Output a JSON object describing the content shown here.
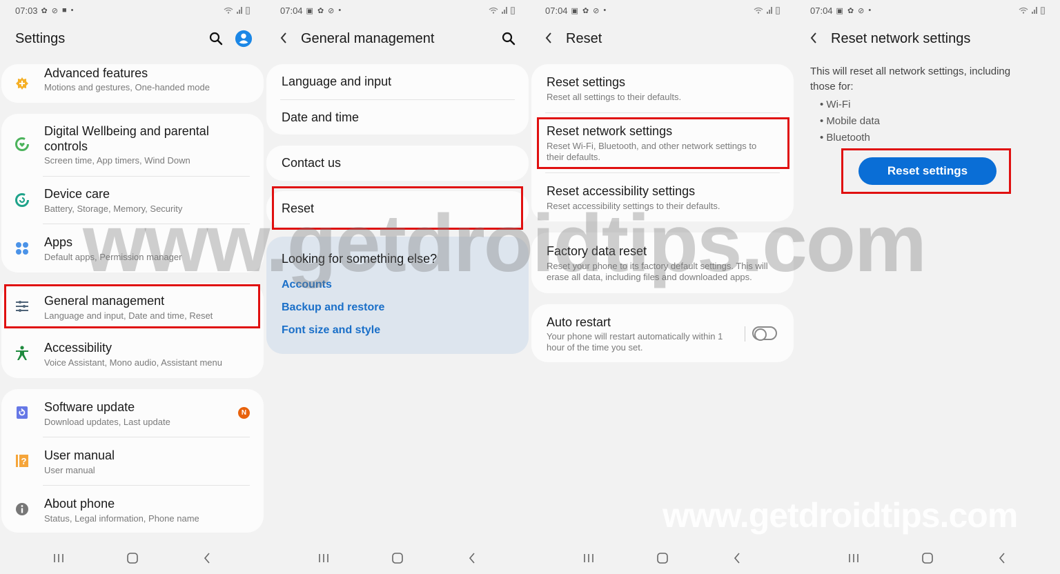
{
  "screens": [
    {
      "status": {
        "time": "07:03"
      },
      "header": {
        "title": "Settings"
      },
      "groups": [
        {
          "items": [
            {
              "title": "Advanced features",
              "subtitle": "Motions and gestures, One-handed mode",
              "icon": "advanced-features-icon"
            }
          ]
        },
        {
          "items": [
            {
              "title": "Digital Wellbeing and parental controls",
              "subtitle": "Screen time, App timers, Wind Down",
              "icon": "digital-wellbeing-icon"
            },
            {
              "title": "Device care",
              "subtitle": "Battery, Storage, Memory, Security",
              "icon": "device-care-icon"
            },
            {
              "title": "Apps",
              "subtitle": "Default apps, Permission manager",
              "icon": "apps-icon"
            }
          ]
        },
        {
          "items": [
            {
              "title": "General management",
              "subtitle": "Language and input, Date and time, Reset",
              "icon": "sliders-icon",
              "highlighted": true
            },
            {
              "title": "Accessibility",
              "subtitle": "Voice Assistant, Mono audio, Assistant menu",
              "icon": "accessibility-icon"
            }
          ]
        },
        {
          "items": [
            {
              "title": "Software update",
              "subtitle": "Download updates, Last update",
              "icon": "software-update-icon",
              "badge": "N"
            },
            {
              "title": "User manual",
              "subtitle": "User manual",
              "icon": "user-manual-icon"
            },
            {
              "title": "About phone",
              "subtitle": "Status, Legal information, Phone name",
              "icon": "info-icon"
            }
          ]
        }
      ]
    },
    {
      "status": {
        "time": "07:04"
      },
      "header": {
        "title": "General management"
      },
      "items": [
        "Language and input",
        "Date and time",
        "Contact us",
        "Reset"
      ],
      "suggestions": {
        "title": "Looking for something else?",
        "links": [
          "Accounts",
          "Backup and restore",
          "Font size and style"
        ]
      }
    },
    {
      "status": {
        "time": "07:04"
      },
      "header": {
        "title": "Reset"
      },
      "items": [
        {
          "title": "Reset settings",
          "subtitle": "Reset all settings to their defaults."
        },
        {
          "title": "Reset network settings",
          "subtitle": "Reset Wi-Fi, Bluetooth, and other network settings to their defaults.",
          "highlighted": true
        },
        {
          "title": "Reset accessibility settings",
          "subtitle": "Reset accessibility settings to their defaults."
        },
        {
          "title": "Factory data reset",
          "subtitle": "Reset your phone to its factory default settings. This will erase all data, including files and downloaded apps."
        },
        {
          "title": "Auto restart",
          "subtitle": "Your phone will restart automatically within 1 hour of the time you set.",
          "toggle": false
        }
      ]
    },
    {
      "status": {
        "time": "07:04"
      },
      "header": {
        "title": "Reset network settings"
      },
      "description": "This will reset all network settings, including those for:",
      "bullets": [
        "Wi-Fi",
        "Mobile data",
        "Bluetooth"
      ],
      "button": "Reset settings"
    }
  ],
  "watermark": "www.getdroidtips.com",
  "colors": {
    "accent": "#0a6ed6",
    "highlight": "#e01010",
    "link": "#1a6fc8",
    "badge": "#e8620c"
  }
}
